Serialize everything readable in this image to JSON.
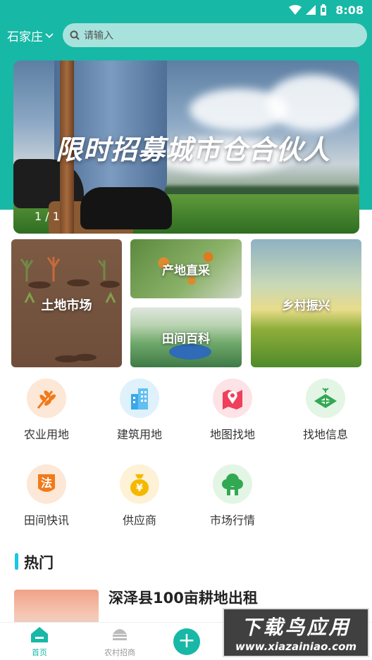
{
  "status_bar": {
    "time": "8:08"
  },
  "header": {
    "city": "石家庄",
    "search_placeholder": "请输入"
  },
  "banner": {
    "title": "限时招募城市仓合伙人",
    "pager": "1 / 1"
  },
  "categories": [
    {
      "label": "土地市场"
    },
    {
      "label": "产地直采"
    },
    {
      "label": "田间百科"
    },
    {
      "label": "乡村振兴"
    }
  ],
  "grid": [
    {
      "label": "农业用地",
      "icon": "wheat-icon"
    },
    {
      "label": "建筑用地",
      "icon": "building-icon"
    },
    {
      "label": "地图找地",
      "icon": "map-pin-icon"
    },
    {
      "label": "找地信息",
      "icon": "land-plot-icon"
    },
    {
      "label": "田间快讯",
      "icon": "law-badge-icon"
    },
    {
      "label": "供应商",
      "icon": "money-bag-icon"
    },
    {
      "label": "市场行情",
      "icon": "tree-house-icon"
    }
  ],
  "hot": {
    "section_title": "热门",
    "item_title": "深泽县100亩耕地出租"
  },
  "bottom_nav": [
    {
      "label": "首页"
    },
    {
      "label": "农村招商"
    }
  ],
  "watermark": {
    "title": "下载鸟应用",
    "url": "www.xiazainiao.com"
  },
  "colors": {
    "brand": "#17b8a6",
    "accent_bar": "#19c7e6"
  }
}
